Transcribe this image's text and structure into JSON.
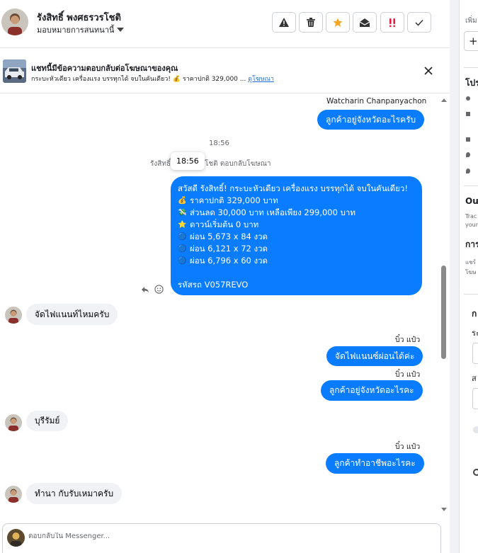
{
  "header": {
    "contact_name": "รังสิทธิ์ พงศธรวรโชติ",
    "assign_label": "มอบหมายการสนทนานี้",
    "toolbar": [
      {
        "name": "report-spam-button",
        "icon": "warning-triangle-icon"
      },
      {
        "name": "delete-button",
        "icon": "trash-icon"
      },
      {
        "name": "star-button",
        "icon": "star-icon"
      },
      {
        "name": "mark-unread-button",
        "icon": "envelope-open-icon"
      },
      {
        "name": "flag-follow-up-button",
        "icon": "exclamation-icon"
      },
      {
        "name": "mark-done-button",
        "icon": "checkmark-icon"
      }
    ]
  },
  "ad_banner": {
    "title": "แชทนี้มีข้อความตอบกลับต่อโฆษณาของคุณ",
    "description": "กระบะหัวเดียว เครื่องแรง บรรทุกได้ จบในคันเดียว! 💰 ราคาปกติ 329,000 ...",
    "view_ad_link": "ดูโฆษณา"
  },
  "chat": {
    "top_sender": "Watcharin Chanpanyachon",
    "messages": [
      {
        "dir": "out",
        "text": "ลูกค้าอยู่จังหวัดอะไรครับ"
      },
      {
        "dir": "in",
        "text": "จัดไฟแนนท์ไหมครับ"
      },
      {
        "dir": "out",
        "sender": "บิ๋ว แป๋ว",
        "text": "จัดไฟแนนซ์ผ่อนได้ค่ะ"
      },
      {
        "dir": "out",
        "sender": "บิ๋ว แป๋ว",
        "text": "ลูกค้าอยู่จังหวัดอะไรคะ"
      },
      {
        "dir": "in",
        "text": "บุรีรัมย์"
      },
      {
        "dir": "out",
        "sender": "บิ๋ว แป๋ว",
        "text": "ลูกค้าทำอาชีพอะไรคะ"
      },
      {
        "dir": "in",
        "text": "ทำนา กับรับเหมาครับ"
      }
    ],
    "timestamp": "18:56",
    "reply_meta_prefix": "รังสิทธิ์",
    "reply_meta_suffix": "โชติ ตอบกลับโฆษณา",
    "tooltip_time": "18:56",
    "ad_reply": {
      "lines": [
        {
          "emoji": "",
          "text": "สวัสดี รังสิทธิ์! กระบะหัวเดียว เครื่องแรง บรรทุกได้ จบในคันเดียว!"
        },
        {
          "emoji": "💰",
          "text": "ราคาปกติ 329,000 บาท"
        },
        {
          "emoji": "💸",
          "text": "ส่วนลด 30,000 บาท เหลือเพียง 299,000 บาท"
        },
        {
          "emoji": "⭐",
          "text": "ดาวน์เริ่มต้น 0 บาท"
        },
        {
          "emoji": "🔵",
          "text": "ผ่อน 5,673 x 84 งวด"
        },
        {
          "emoji": "🔵",
          "text": "ผ่อน 6,121 x 72 งวด"
        },
        {
          "emoji": "🔵",
          "text": "ผ่อน 6,796 x 60 งวด"
        },
        {
          "emoji": "",
          "text": ""
        },
        {
          "emoji": "",
          "text": "รหัสรถ V057REVO"
        }
      ]
    }
  },
  "composer": {
    "placeholder": "ตอบกลับใน Messenger..."
  },
  "right_panel": {
    "top_label": "เพิ่ม",
    "add_symbol": "+",
    "section_profile": "โปร",
    "section_out": "Out",
    "out_sub1": "Trac",
    "out_sub2": "your",
    "section_action": "การ",
    "action_sub1": "แชร์",
    "action_sub2": "โฆษ",
    "section_lower": "ก",
    "field1_label": "ระ",
    "field2_label": "ส"
  },
  "colors": {
    "outgoing_bubble": "#0a7cff",
    "incoming_bubble": "#f0f2f5",
    "link": "#216fdb",
    "star": "#f5a623",
    "flag": "#e41e3f"
  }
}
